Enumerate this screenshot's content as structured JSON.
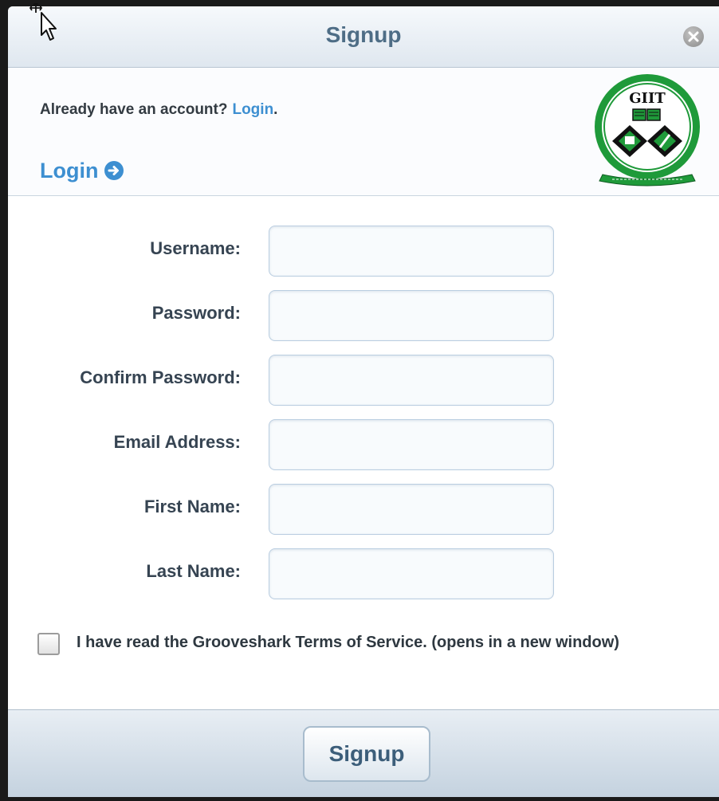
{
  "dialog": {
    "title": "Signup"
  },
  "login_section": {
    "already_text": "Already have an account?",
    "login_link": "Login",
    "period": ".",
    "login_arrow_label": "Login",
    "logo_text": "GIIT"
  },
  "form": {
    "fields": [
      {
        "label": "Username:",
        "value": ""
      },
      {
        "label": "Password:",
        "value": ""
      },
      {
        "label": "Confirm Password:",
        "value": ""
      },
      {
        "label": "Email Address:",
        "value": ""
      },
      {
        "label": "First Name:",
        "value": ""
      },
      {
        "label": "Last Name:",
        "value": ""
      }
    ],
    "tos_text": "I have read the Grooveshark Terms of Service. (opens in a new window)",
    "tos_checked": false
  },
  "footer": {
    "signup_label": "Signup"
  },
  "colors": {
    "link": "#3d8fd1",
    "title": "#4e6d86",
    "logo_green": "#1f9a3a"
  },
  "icons": [
    "close-icon",
    "arrow-right-circle-icon",
    "checkbox-icon",
    "mouse-cursor-icon",
    "giit-logo"
  ]
}
